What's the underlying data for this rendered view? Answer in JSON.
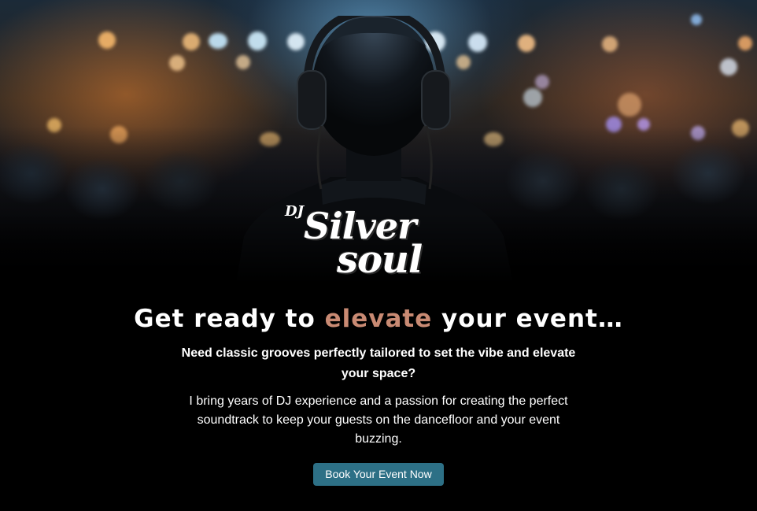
{
  "brand": {
    "logo_dj": "DJ",
    "logo_line1": "Silver",
    "logo_line2": "soul"
  },
  "hero": {
    "headline_pre": "Get ready to ",
    "headline_accent": "elevate",
    "headline_post": " your event…",
    "subhead": "Need classic grooves perfectly tailored to set the vibe and elevate your space?",
    "body": "I bring years of DJ experience and a passion for creating the perfect soundtrack to keep your guests on the dancefloor and your event buzzing.",
    "cta_label": "Book Your Event Now"
  },
  "colors": {
    "accent": "#c98a73",
    "button": "#2d7086",
    "background": "#000000"
  },
  "icons": {
    "hero_image": "dj-with-headphones-photo"
  }
}
